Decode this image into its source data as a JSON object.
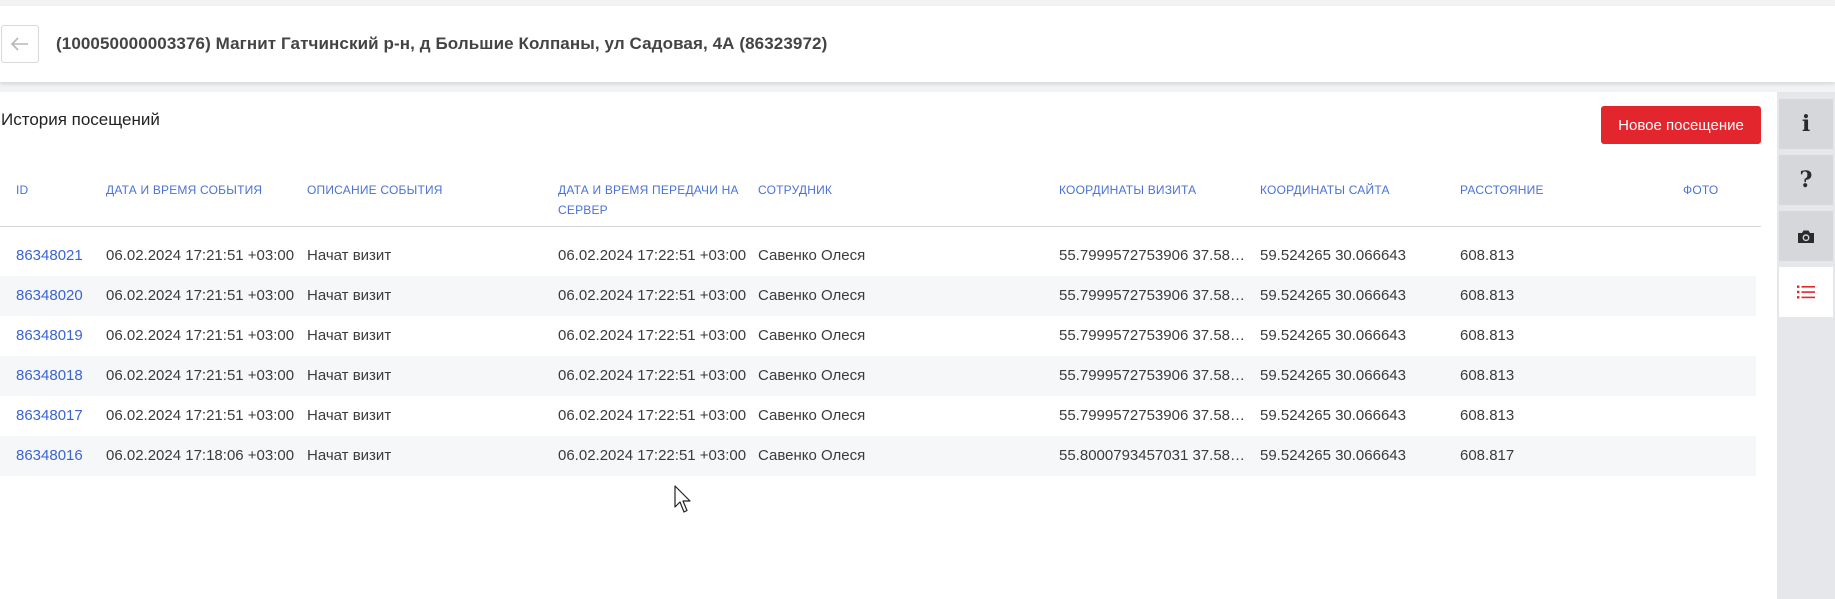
{
  "header": {
    "back_icon": "arrow-left-icon",
    "title": "(100050000003376) Магнит Гатчинский р-н, д Большие Колпаны, ул Садовая, 4А (86323972)"
  },
  "section": {
    "title": "История посещений",
    "new_visit_label": "Новое посещение"
  },
  "table": {
    "columns": {
      "id": "ID",
      "date": "ДАТА И ВРЕМЯ СОБЫТИЯ",
      "desc": "ОПИСАНИЕ СОБЫТИЯ",
      "sent": "ДАТА И ВРЕМЯ ПЕРЕДАЧИ НА СЕРВЕР",
      "employee": "СОТРУДНИК",
      "visit_coords": "КООРДИНАТЫ ВИЗИТА",
      "site_coords": "КООРДИНАТЫ САЙТА",
      "distance": "РАССТОЯНИЕ",
      "photo": "ФОТО"
    },
    "rows": [
      {
        "id": "86348021",
        "date": "06.02.2024 17:21:51 +03:00",
        "desc": "Начат визит",
        "sent": "06.02.2024 17:22:51 +03:00",
        "employee": "Савенко Олеся",
        "visit_coords": "55.7999572753906 37.584...",
        "site_coords": "59.524265 30.066643",
        "distance": "608.813",
        "photo": ""
      },
      {
        "id": "86348020",
        "date": "06.02.2024 17:21:51 +03:00",
        "desc": "Начат визит",
        "sent": "06.02.2024 17:22:51 +03:00",
        "employee": "Савенко Олеся",
        "visit_coords": "55.7999572753906 37.584...",
        "site_coords": "59.524265 30.066643",
        "distance": "608.813",
        "photo": ""
      },
      {
        "id": "86348019",
        "date": "06.02.2024 17:21:51 +03:00",
        "desc": "Начат визит",
        "sent": "06.02.2024 17:22:51 +03:00",
        "employee": "Савенко Олеся",
        "visit_coords": "55.7999572753906 37.584...",
        "site_coords": "59.524265 30.066643",
        "distance": "608.813",
        "photo": ""
      },
      {
        "id": "86348018",
        "date": "06.02.2024 17:21:51 +03:00",
        "desc": "Начат визит",
        "sent": "06.02.2024 17:22:51 +03:00",
        "employee": "Савенко Олеся",
        "visit_coords": "55.7999572753906 37.584...",
        "site_coords": "59.524265 30.066643",
        "distance": "608.813",
        "photo": ""
      },
      {
        "id": "86348017",
        "date": "06.02.2024 17:21:51 +03:00",
        "desc": "Начат визит",
        "sent": "06.02.2024 17:22:51 +03:00",
        "employee": "Савенко Олеся",
        "visit_coords": "55.7999572753906 37.584...",
        "site_coords": "59.524265 30.066643",
        "distance": "608.813",
        "photo": ""
      },
      {
        "id": "86348016",
        "date": "06.02.2024 17:18:06 +03:00",
        "desc": "Начат визит",
        "sent": "06.02.2024 17:22:51 +03:00",
        "employee": "Савенко Олеся",
        "visit_coords": "55.8000793457031 37.584...",
        "site_coords": "59.524265 30.066643",
        "distance": "608.817",
        "photo": ""
      }
    ]
  },
  "side_panel": {
    "buttons": [
      {
        "icon": "info-icon",
        "glyph": "i",
        "active": false
      },
      {
        "icon": "help-icon",
        "glyph": "?",
        "active": false
      },
      {
        "icon": "camera-icon",
        "glyph": "",
        "active": false
      },
      {
        "icon": "list-icon",
        "glyph": "",
        "active": true
      }
    ]
  },
  "colors": {
    "accent": "#e3262e",
    "link": "#3a64d4",
    "header_text": "#4a72d6"
  }
}
